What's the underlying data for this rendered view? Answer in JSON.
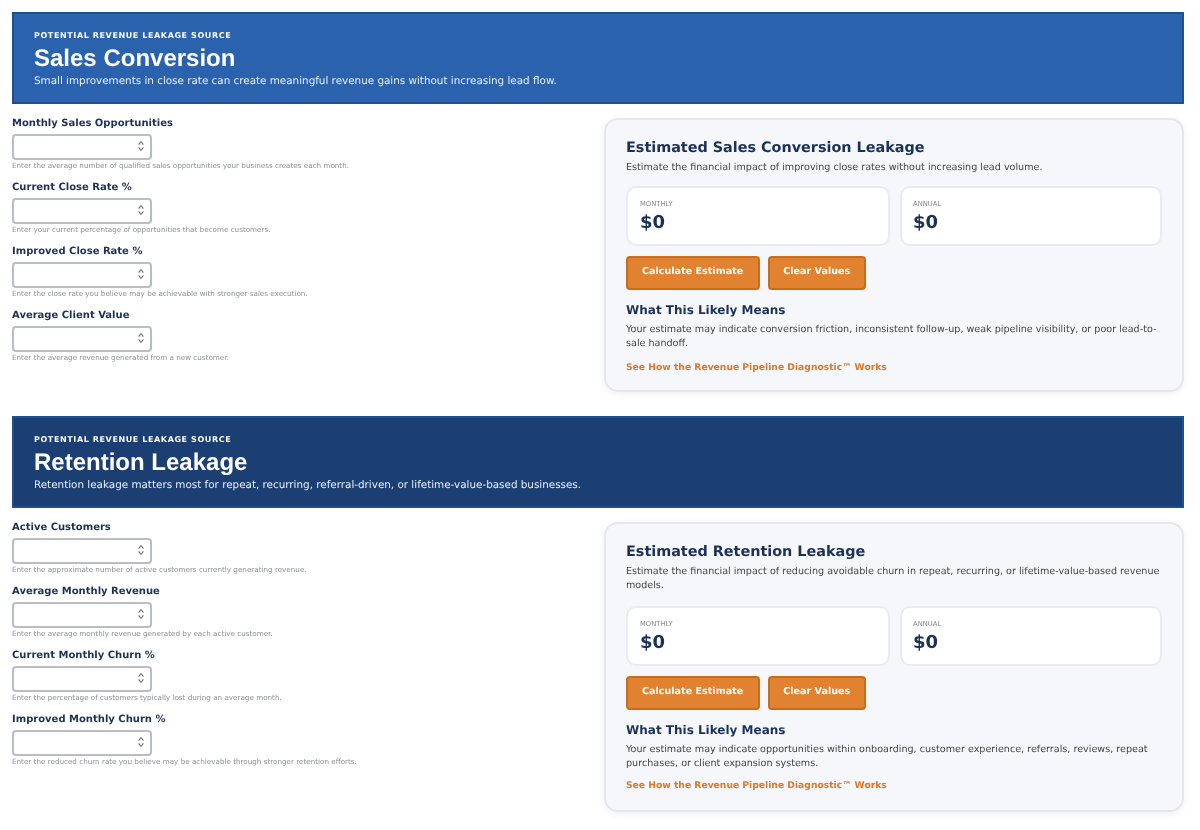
{
  "sections": [
    {
      "eyebrow": "POTENTIAL REVENUE LEAKAGE SOURCE",
      "title": "Sales Conversion",
      "subtitle": "Small improvements in close rate can create meaningful revenue gains without increasing lead flow.",
      "color": "#2a62ad",
      "fields": [
        {
          "label": "Monthly Sales Opportunities",
          "help": "Enter the average number of qualified sales opportunities your business creates each month."
        },
        {
          "label": "Current Close Rate %",
          "help": "Enter your current percentage of opportunities that become customers."
        },
        {
          "label": "Improved Close Rate %",
          "help": "Enter the close rate you believe may be achievable with stronger sales execution."
        },
        {
          "label": "Average Client Value",
          "help": "Enter the average revenue generated from a new customer."
        }
      ],
      "card": {
        "title": "Estimated Sales Conversion Leakage",
        "description": "Estimate the financial impact of improving close rates without increasing lead volume.",
        "stats": [
          {
            "label": "MONTHLY",
            "value": "$0"
          },
          {
            "label": "ANNUAL",
            "value": "$0"
          }
        ],
        "buttons": [
          "Calculate Estimate",
          "Clear Values"
        ],
        "meaning_title": "What This Likely Means",
        "meaning_text": "Your estimate may indicate conversion friction, inconsistent follow-up, weak pipeline visibility, or poor lead-to-sale handoff.",
        "link": "See How the Revenue Pipeline Diagnostic™ Works"
      }
    },
    {
      "eyebrow": "POTENTIAL REVENUE LEAKAGE SOURCE",
      "title": "Retention Leakage",
      "subtitle": "Retention leakage matters most for repeat, recurring, referral-driven, or lifetime-value-based businesses.",
      "color": "#1c3f73",
      "fields": [
        {
          "label": "Active Customers",
          "help": "Enter the approximate number of active customers currently generating revenue."
        },
        {
          "label": "Average Monthly Revenue",
          "help": "Enter the average monthly revenue generated by each active customer."
        },
        {
          "label": "Current Monthly Churn %",
          "help": "Enter the percentage of customers typically lost during an average month."
        },
        {
          "label": "Improved Monthly Churn %",
          "help": "Enter the reduced churn rate you believe may be achievable through stronger retention efforts."
        }
      ],
      "card": {
        "title": "Estimated Retention Leakage",
        "description": "Estimate the financial impact of reducing avoidable churn in repeat, recurring, or lifetime-value-based revenue models.",
        "stats": [
          {
            "label": "MONTHLY",
            "value": "$0"
          },
          {
            "label": "ANNUAL",
            "value": "$0"
          }
        ],
        "buttons": [
          "Calculate Estimate",
          "Clear Values"
        ],
        "meaning_title": "What This Likely Means",
        "meaning_text": "Your estimate may indicate opportunities within onboarding, customer experience, referrals, reviews, repeat purchases, or client expansion systems.",
        "link": "See How the Revenue Pipeline Diagnostic™ Works"
      }
    }
  ]
}
